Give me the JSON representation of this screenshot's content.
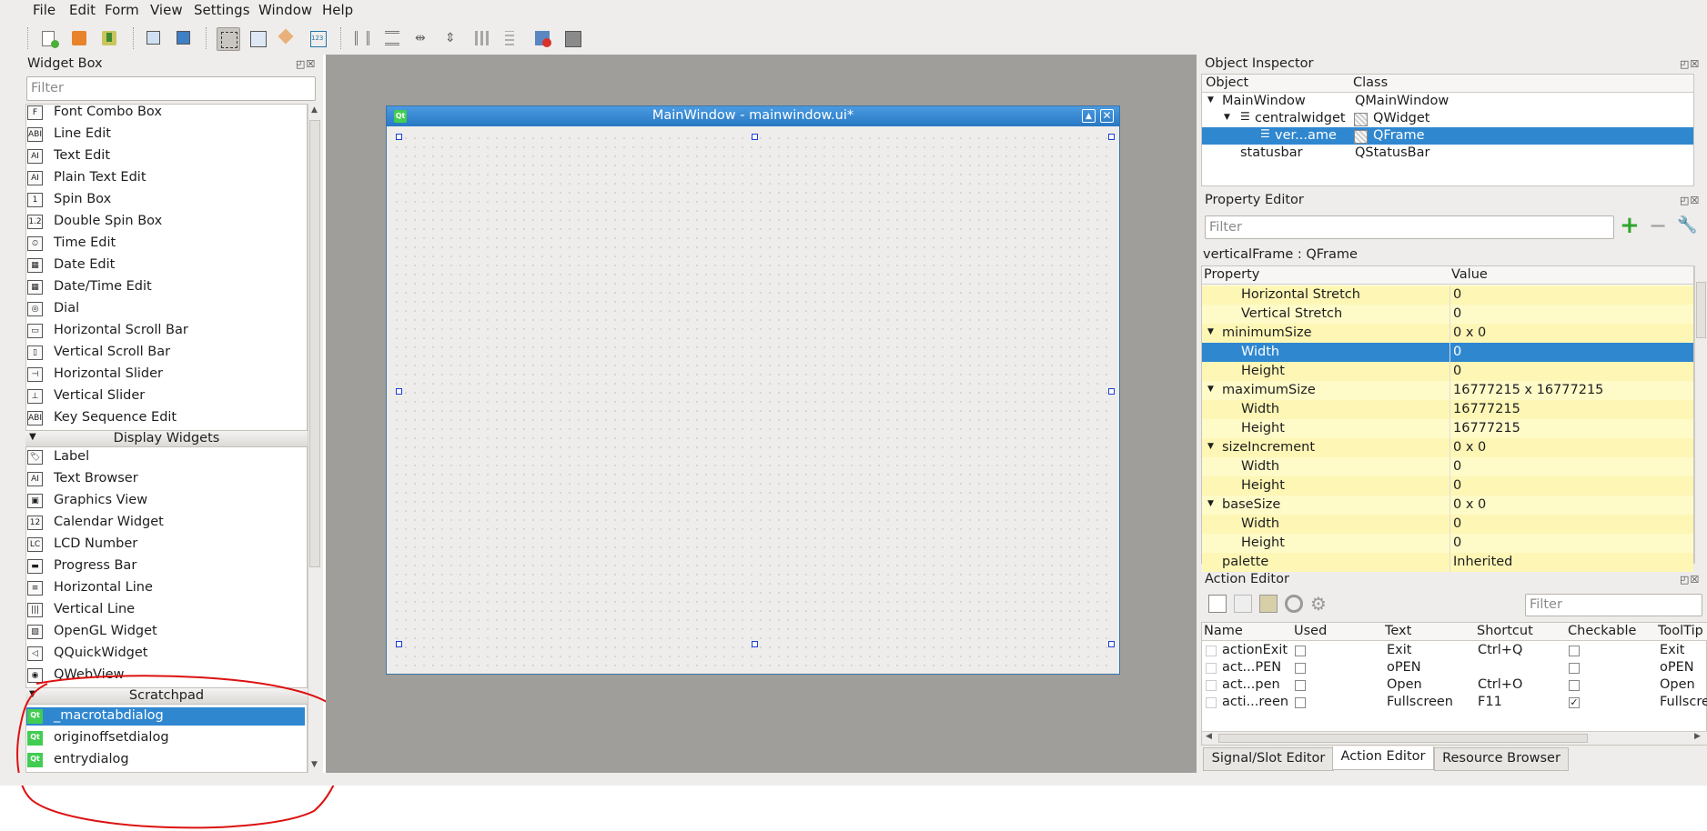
{
  "menu": [
    "File",
    "Edit",
    "Form",
    "View",
    "Settings",
    "Window",
    "Help"
  ],
  "toolbar_icons": [
    "new-form-icon",
    "open-form-icon",
    "save-form-icon",
    "send-to-back-icon",
    "bring-to-front-icon",
    "edit-widgets-icon",
    "edit-signals-icon",
    "edit-buddies-icon",
    "edit-tab-order-icon",
    "layout-horizontal-icon",
    "layout-vertical-icon",
    "layout-h-splitter-icon",
    "layout-v-splitter-icon",
    "layout-grid-icon",
    "layout-form-icon",
    "break-layout-icon",
    "adjust-size-icon"
  ],
  "widget_box": {
    "title": "Widget Box",
    "filter_placeholder": "Filter",
    "input_widgets": [
      "Font Combo Box",
      "Line Edit",
      "Text Edit",
      "Plain Text Edit",
      "Spin Box",
      "Double Spin Box",
      "Time Edit",
      "Date Edit",
      "Date/Time Edit",
      "Dial",
      "Horizontal Scroll Bar",
      "Vertical Scroll Bar",
      "Horizontal Slider",
      "Vertical Slider",
      "Key Sequence Edit"
    ],
    "input_icons": [
      "F",
      "ABI",
      "AI",
      "AI",
      "1",
      "1.2",
      "⏲",
      "▦",
      "▦",
      "◎",
      "▭",
      "▯",
      "⊣",
      "⊥",
      "ABI"
    ],
    "display_header": "Display Widgets",
    "display_widgets": [
      "Label",
      "Text Browser",
      "Graphics View",
      "Calendar Widget",
      "LCD Number",
      "Progress Bar",
      "Horizontal Line",
      "Vertical Line",
      "OpenGL Widget",
      "QQuickWidget",
      "QWebView"
    ],
    "display_icons": [
      "🏷",
      "AI",
      "▣",
      "12",
      "LC",
      "▬",
      "≡",
      "|||",
      "▨",
      "◁",
      "◉"
    ],
    "scratch_header": "Scratchpad",
    "scratch_items": [
      "_macrotabdialog",
      "originoffsetdialog",
      "entrydialog"
    ],
    "qt_icon_label": "Qt"
  },
  "form": {
    "title": "MainWindow - mainwindow.ui*"
  },
  "object_inspector": {
    "title": "Object Inspector",
    "col_object": "Object",
    "col_class": "Class",
    "rows": [
      {
        "object": "MainWindow",
        "class": "QMainWindow"
      },
      {
        "object": "centralwidget",
        "class": "QWidget"
      },
      {
        "object": "ver...ame",
        "class": "QFrame"
      },
      {
        "object": "statusbar",
        "class": "QStatusBar"
      }
    ]
  },
  "property_editor": {
    "title": "Property Editor",
    "filter_placeholder": "Filter",
    "context": "verticalFrame : QFrame",
    "col_property": "Property",
    "col_value": "Value",
    "rows": [
      {
        "p": "Horizontal Stretch",
        "v": "0"
      },
      {
        "p": "Vertical Stretch",
        "v": "0"
      },
      {
        "p": "minimumSize",
        "v": "0 x 0"
      },
      {
        "p": "Width",
        "v": "0"
      },
      {
        "p": "Height",
        "v": "0"
      },
      {
        "p": "maximumSize",
        "v": "16777215 x 16777215"
      },
      {
        "p": "Width",
        "v": "16777215"
      },
      {
        "p": "Height",
        "v": "16777215"
      },
      {
        "p": "sizeIncrement",
        "v": "0 x 0"
      },
      {
        "p": "Width",
        "v": "0"
      },
      {
        "p": "Height",
        "v": "0"
      },
      {
        "p": "baseSize",
        "v": "0 x 0"
      },
      {
        "p": "Width",
        "v": "0"
      },
      {
        "p": "Height",
        "v": "0"
      },
      {
        "p": "palette",
        "v": "Inherited"
      }
    ]
  },
  "action_editor": {
    "title": "Action Editor",
    "filter_placeholder": "Filter",
    "columns": [
      "Name",
      "Used",
      "Text",
      "Shortcut",
      "Checkable",
      "ToolTip"
    ],
    "rows": [
      {
        "name": "actionExit",
        "text": "Exit",
        "shortcut": "Ctrl+Q",
        "checkable": "",
        "tooltip": "Exit"
      },
      {
        "name": "act...PEN",
        "text": "oPEN",
        "shortcut": "",
        "checkable": "",
        "tooltip": "oPEN"
      },
      {
        "name": "act...pen",
        "text": "Open",
        "shortcut": "Ctrl+O",
        "checkable": "",
        "tooltip": "Open"
      },
      {
        "name": "acti...reen",
        "text": "Fullscreen",
        "shortcut": "F11",
        "checkable": "✓",
        "tooltip": "Fullscreen"
      }
    ]
  },
  "bottom_tabs": [
    "Signal/Slot Editor",
    "Action Editor",
    "Resource Browser"
  ]
}
